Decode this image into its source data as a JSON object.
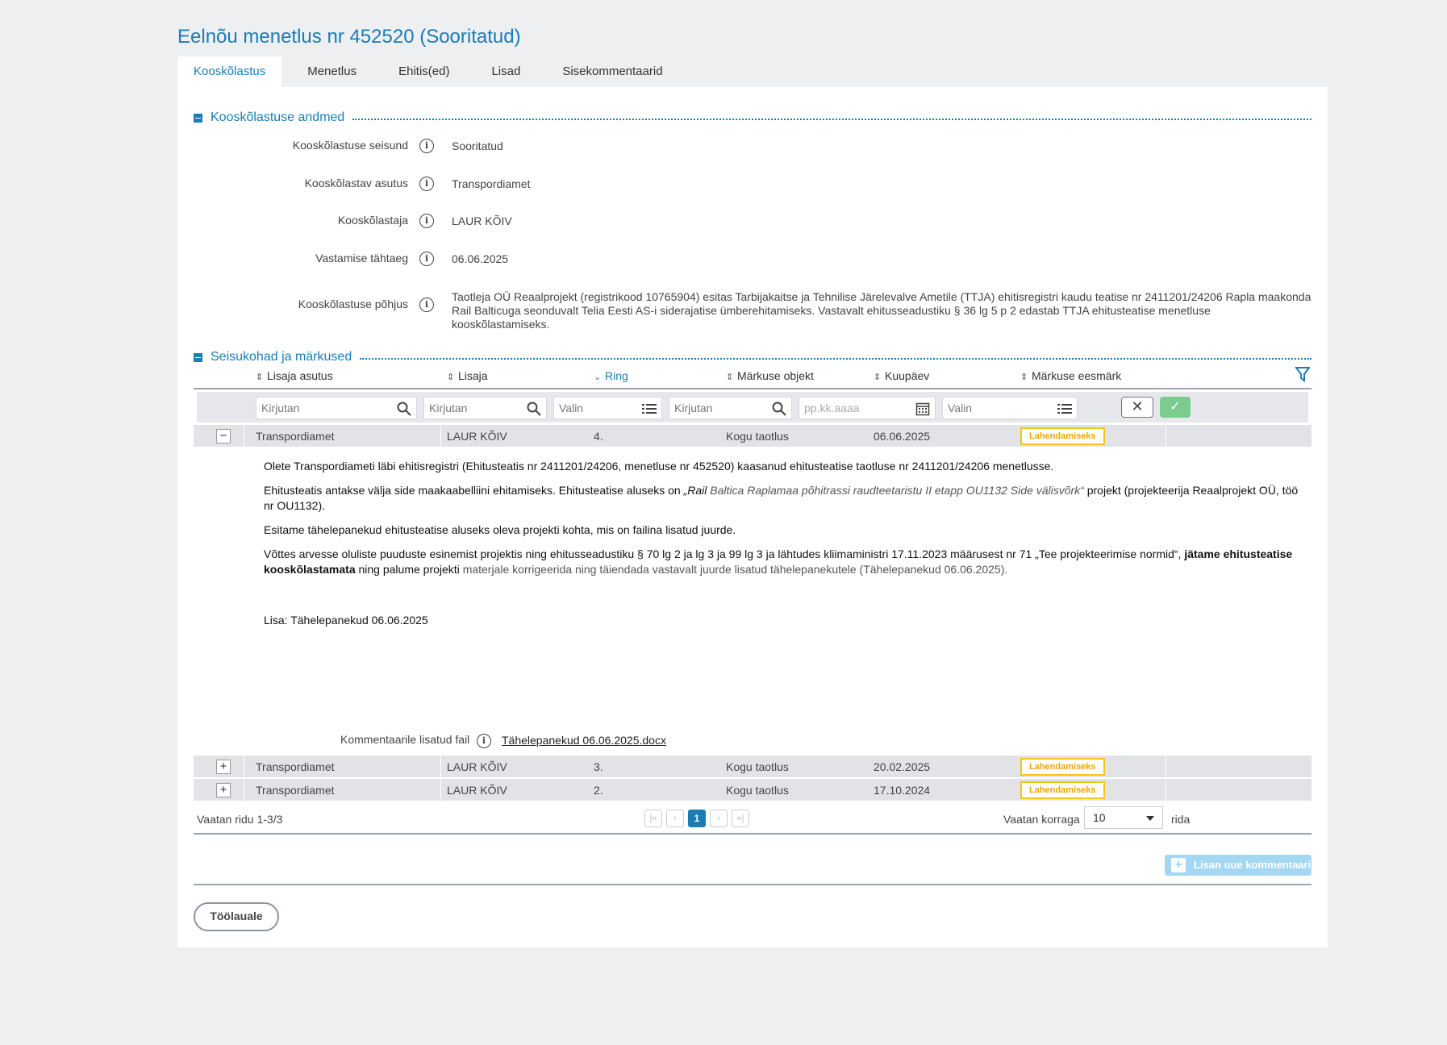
{
  "page": {
    "title": "Eelnõu menetlus nr 452520 (Sooritatud)"
  },
  "tabs": [
    {
      "label": "Kooskõlastus",
      "active": true
    },
    {
      "label": "Menetlus"
    },
    {
      "label": "Ehitis(ed)"
    },
    {
      "label": "Lisad"
    },
    {
      "label": "Sisekommentaarid"
    }
  ],
  "section1": {
    "title": "Kooskõlastuse andmed",
    "fields": [
      {
        "label": "Kooskõlastuse seisund",
        "value": "Sooritatud"
      },
      {
        "label": "Kooskõlastav asutus",
        "value": "Transpordiamet"
      },
      {
        "label": "Kooskõlastaja",
        "value": "LAUR KÕIV"
      },
      {
        "label": "Vastamise tähtaeg",
        "value": "06.06.2025"
      },
      {
        "label": "Kooskõlastuse põhjus",
        "value": "Taotleja OÜ Reaalprojekt (registrikood 10765904) esitas Tarbijakaitse ja Tehnilise Järelevalve Ametile (TTJA) ehitisregistri kaudu teatise nr 2411201/24206 Rapla maakonda Rail Balticuga seonduvalt Telia Eesti AS-i siderajatise ümberehitamiseks. Vastavalt ehitusseadustiku § 36 lg 5 p 2 edastab TTJA ehitusteatise menetluse kooskõlastamiseks."
      }
    ]
  },
  "section2": {
    "title": "Seisukohad ja märkused",
    "columns": [
      "Lisaja asutus",
      "Lisaja",
      "Ring",
      "Märkuse objekt",
      "Kuupäev",
      "Märkuse eesmärk"
    ],
    "filters": {
      "asutus_placeholder": "Kirjutan",
      "lisaja_placeholder": "Kirjutan",
      "ring_placeholder": "Valin",
      "objekt_placeholder": "Kirjutan",
      "kuupaev_placeholder": "pp.kk.aaaa",
      "eesmark_placeholder": "Valin"
    },
    "rows": [
      {
        "toggle": "−",
        "asutus": "Transpordiamet",
        "lisaja": "LAUR KÕIV",
        "ring": "4.",
        "objekt": "Kogu taotlus",
        "kuupaev": "06.06.2025",
        "eesmark": "Lahendamiseks"
      },
      {
        "toggle": "+",
        "asutus": "Transpordiamet",
        "lisaja": "LAUR KÕIV",
        "ring": "3.",
        "objekt": "Kogu taotlus",
        "kuupaev": "20.02.2025",
        "eesmark": "Lahendamiseks"
      },
      {
        "toggle": "+",
        "asutus": "Transpordiamet",
        "lisaja": "LAUR KÕIV",
        "ring": "2.",
        "objekt": "Kogu taotlus",
        "kuupaev": "17.10.2024",
        "eesmark": "Lahendamiseks"
      }
    ],
    "detail": {
      "p1": "Olete Transpordiameti läbi ehitisregistri (Ehitusteatis nr 2411201/24206, menetluse nr 452520) kaasanud ehitusteatise taotluse nr 2411201/24206 menetlusse.",
      "p2_a": "Ehitusteatis antakse välja side maakaabelliini ehitamiseks. Ehitusteatise aluseks on ",
      "p2_quote_open": "„Rail ",
      "p2_italic": "Baltica Raplamaa põhitrassi raudteetaristu II etapp OU1132 Side välisvõrk“",
      "p2_b": " projekt (projekteerija Reaalprojekt OÜ, töö nr OU1132).",
      "p3": "Esitame tähelepanekud ehitusteatise aluseks oleva projekti kohta, mis on failina lisatud juurde.",
      "p4_a": "Võttes arvesse oluliste puuduste esinemist projektis ning ehitusseadustiku § 70 lg 2 ja lg 3 ja 99 lg 3 ja lähtudes kliimaministri 17.11.2023 määrusest nr 71 „Tee projekteerimise normid“, ",
      "p4_bold": "jätame ehitusteatise kooskõlastamata",
      "p4_b": " ning palume projekti ",
      "p4_muted": "materjale korrigeerida ning täiendada vastavalt juurde lisatud tähelepanekutele (Tähelepanekud 06.06.2025).",
      "p5": "Lisa: Tähelepanekud 06.06.2025",
      "attachment_label": "Kommentaarile lisatud fail",
      "attachment_file": "Tähelepanekud 06.06.2025.docx"
    },
    "pager": {
      "count": "Vaatan ridu 1-3/3",
      "first": "|«",
      "prev": "‹",
      "current": "1",
      "next": "›",
      "last": "»|",
      "per_page_label": "Vaatan korraga",
      "per_page_value": "10",
      "per_page_suffix": "rida"
    },
    "add_comment": "Lisan uue kommentaari"
  },
  "footer": {
    "back_button": "Töölauale"
  },
  "colors": {
    "accent": "#1a7db5",
    "badge_border": "#f5c518",
    "badge_text": "#f0a500",
    "ok": "#7ecb8f"
  }
}
